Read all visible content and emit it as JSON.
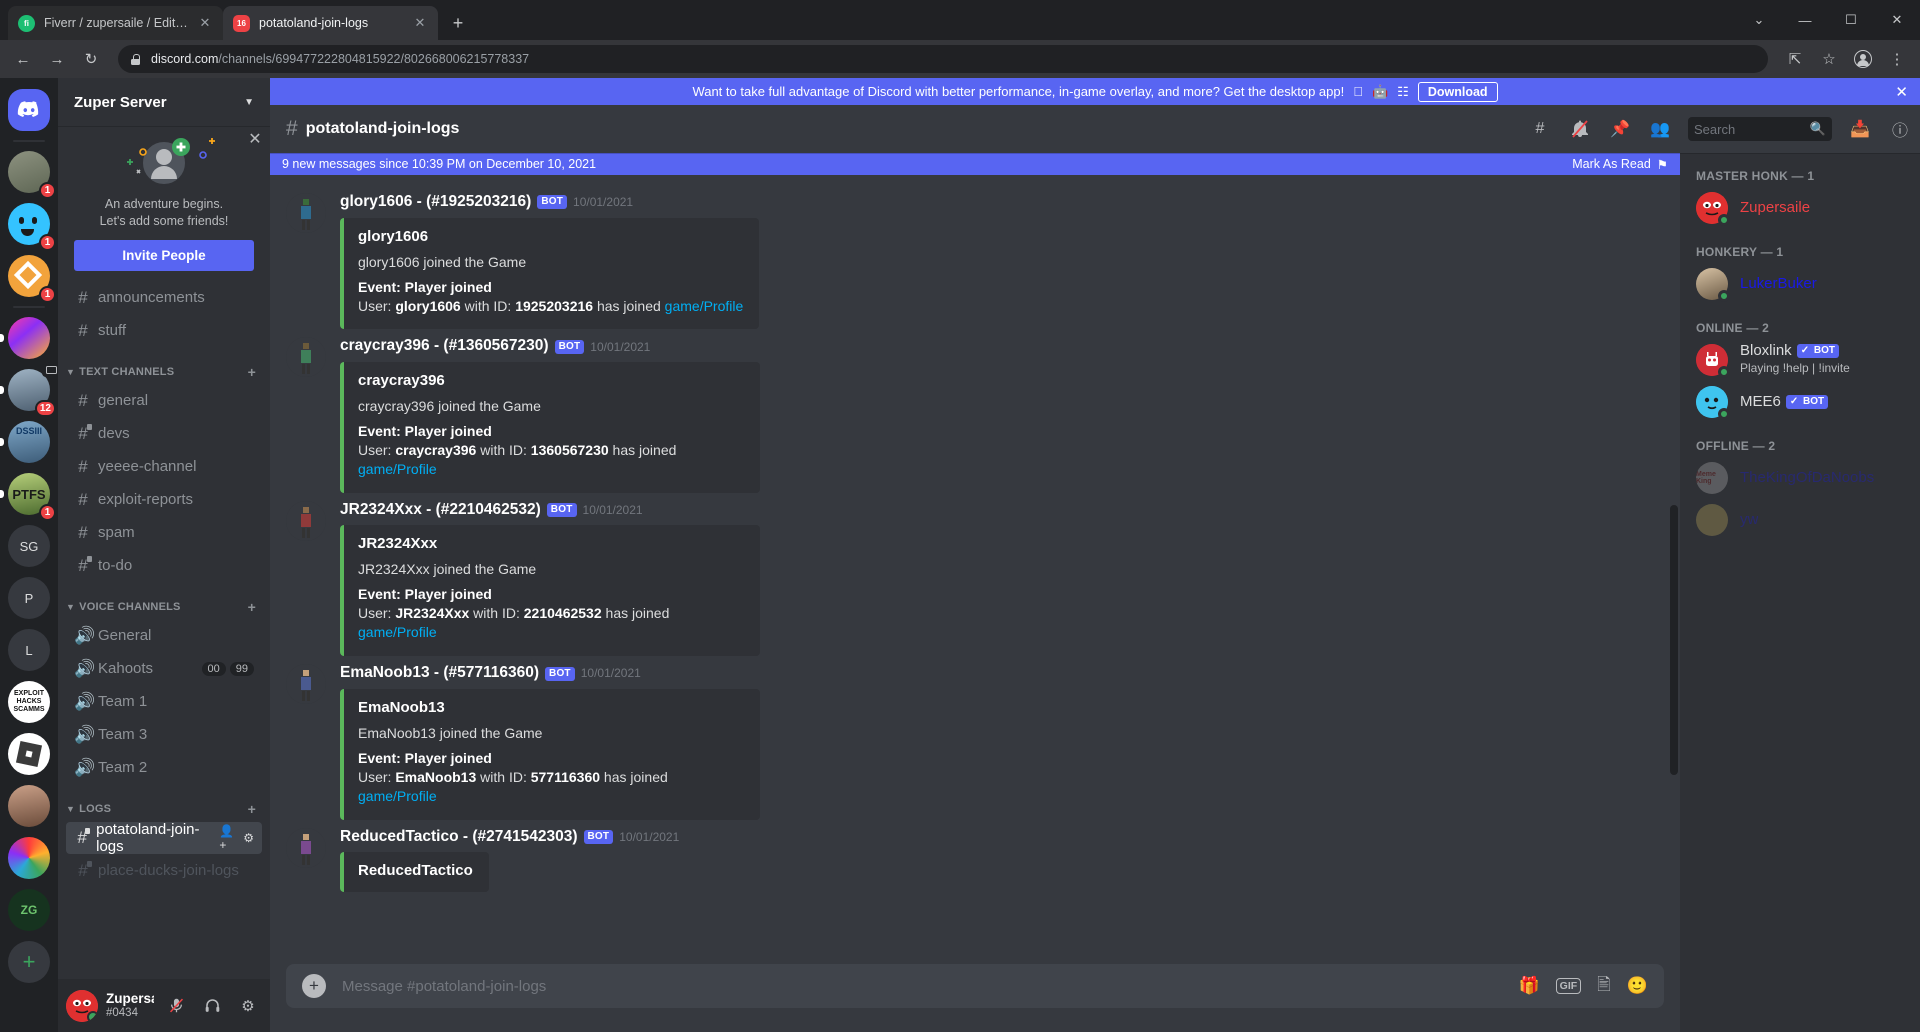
{
  "browser": {
    "tabs": [
      {
        "title": "Fiverr / zupersaile / Edit Gig",
        "favicon": "fiverr-icon",
        "active": false
      },
      {
        "title": "potatoland-join-logs",
        "favicon": "discord-icon",
        "active": true
      }
    ],
    "new_tab_label": "+",
    "url_domain": "discord.com",
    "url_path": "/channels/699477222804815922/802668006215778337",
    "window_controls": {
      "minimize": "—",
      "maximize": "☐",
      "close": "✕",
      "dropdown": "⌄"
    },
    "nav": {
      "back": "←",
      "forward": "→",
      "reload": "↻",
      "share": "share-icon",
      "star": "☆",
      "menu": "⋮"
    }
  },
  "server_rail": {
    "home_label": "discord-home",
    "servers": [
      {
        "name": "home",
        "badge": "",
        "unread": false,
        "color": "#5865f2",
        "initial": ""
      },
      {
        "name": "boat-server",
        "badge": "1",
        "unread": false,
        "color": "#7a7f6e",
        "initial": ""
      },
      {
        "name": "blue-face-server",
        "badge": "1",
        "unread": false,
        "color": "#34c3ff",
        "initial": ""
      },
      {
        "name": "orange-square-server",
        "badge": "1",
        "unread": false,
        "color": "#f2a33c",
        "initial": ""
      },
      {
        "name": "rainbow-emoji-server",
        "badge": "",
        "unread": true,
        "color": "#c13fd6",
        "initial": ""
      },
      {
        "name": "plane-server",
        "badge": "12",
        "unread": true,
        "color": "#6f8aa0",
        "initial": ""
      },
      {
        "name": "dossiii-server",
        "badge": "",
        "unread": true,
        "color": "#4c6f93",
        "initial": ""
      },
      {
        "name": "ptfs-server",
        "badge": "1",
        "unread": true,
        "color": "#6e8a4a",
        "initial": ""
      },
      {
        "name": "sg-server",
        "badge": "",
        "unread": false,
        "color": "#36393f",
        "initial": "SG"
      },
      {
        "name": "p-server",
        "badge": "",
        "unread": false,
        "color": "#36393f",
        "initial": "P"
      },
      {
        "name": "l-server",
        "badge": "",
        "unread": false,
        "color": "#36393f",
        "initial": "L"
      },
      {
        "name": "exploit-hacks-scamms-server",
        "badge": "",
        "unread": false,
        "color": "#ffffff",
        "initial": ""
      },
      {
        "name": "roblox-server",
        "badge": "",
        "unread": false,
        "color": "#ffffff",
        "initial": ""
      },
      {
        "name": "person-photo-server",
        "badge": "",
        "unread": false,
        "color": "#8a6f5a",
        "initial": ""
      },
      {
        "name": "rainbow-server",
        "badge": "",
        "unread": false,
        "color": "#2ba9d8",
        "initial": ""
      },
      {
        "name": "zg-server",
        "badge": "",
        "unread": false,
        "color": "#1f3d2b",
        "initial": "ZG"
      }
    ],
    "add_server_label": "+"
  },
  "sidebar": {
    "server_name": "Zuper Server",
    "promo": {
      "line1": "An adventure begins.",
      "line2": "Let's add some friends!",
      "button": "Invite People",
      "close": "✕"
    },
    "top_channels": [
      {
        "name": "announcements",
        "locked": false
      },
      {
        "name": "stuff",
        "locked": false
      }
    ],
    "categories": [
      {
        "name": "TEXT CHANNELS",
        "channels": [
          {
            "name": "general",
            "locked": false,
            "state": "normal"
          },
          {
            "name": "devs",
            "locked": true,
            "state": "normal"
          },
          {
            "name": "yeeee-channel",
            "locked": false,
            "state": "normal"
          },
          {
            "name": "exploit-reports",
            "locked": false,
            "state": "normal"
          },
          {
            "name": "spam",
            "locked": false,
            "state": "normal"
          },
          {
            "name": "to-do",
            "locked": true,
            "state": "normal"
          }
        ]
      },
      {
        "name": "VOICE CHANNELS",
        "channels": [
          {
            "name": "General",
            "voice": true,
            "state": "normal"
          },
          {
            "name": "Kahoots",
            "voice": true,
            "state": "normal",
            "badges": [
              "00",
              "99"
            ]
          },
          {
            "name": "Team 1",
            "voice": true,
            "state": "normal"
          },
          {
            "name": "Team 3",
            "voice": true,
            "state": "normal"
          },
          {
            "name": "Team 2",
            "voice": true,
            "state": "normal"
          }
        ]
      },
      {
        "name": "LOGS",
        "channels": [
          {
            "name": "potatoland-join-logs",
            "locked": true,
            "state": "active"
          },
          {
            "name": "place-ducks-join-logs",
            "locked": true,
            "state": "muted"
          }
        ]
      }
    ],
    "user": {
      "name": "Zupersaile",
      "tag": "#0434",
      "mic_icon": "mic-muted-icon",
      "headset_icon": "headphones-icon",
      "settings_icon": "gear-icon"
    }
  },
  "banner": {
    "text": "Want to take full advantage of Discord with better performance, in-game overlay, and more? Get the desktop app!",
    "download_label": "Download",
    "close": "✕",
    "platform_icons": [
      "apple-icon",
      "android-icon",
      "windows-icon"
    ]
  },
  "channel_header": {
    "title": "potatoland-join-logs",
    "icons": [
      "threads-icon",
      "notification-off-icon",
      "pin-icon",
      "members-icon"
    ],
    "search_placeholder": "Search",
    "right_icons": [
      "inbox-icon",
      "help-icon"
    ]
  },
  "new_messages_bar": {
    "text": "9 new messages since 10:39 PM on December 10, 2021",
    "mark_as_read": "Mark As Read"
  },
  "messages": [
    {
      "author": "glory1606 - (#1925203216)",
      "bot_label": "BOT",
      "timestamp": "10/01/2021",
      "embed": {
        "color": "#5bb85b",
        "title": "glory1606",
        "description": "glory1606 joined the Game",
        "field_name": "Event: Player joined",
        "field_prefix": "User: ",
        "field_user": "glory1606",
        "field_mid": " with ID: ",
        "field_id": "1925203216",
        "field_suffix": " has joined ",
        "link_game": "game",
        "link_sep": "/",
        "link_profile": "Profile"
      }
    },
    {
      "author": "craycray396 - (#1360567230)",
      "bot_label": "BOT",
      "timestamp": "10/01/2021",
      "embed": {
        "color": "#5bb85b",
        "title": "craycray396",
        "description": "craycray396 joined the Game",
        "field_name": "Event: Player joined",
        "field_prefix": "User: ",
        "field_user": "craycray396",
        "field_mid": " with ID: ",
        "field_id": "1360567230",
        "field_suffix": " has joined ",
        "link_game": "game",
        "link_sep": "/",
        "link_profile": "Profile"
      }
    },
    {
      "author": "JR2324Xxx - (#2210462532)",
      "bot_label": "BOT",
      "timestamp": "10/01/2021",
      "embed": {
        "color": "#5bb85b",
        "title": "JR2324Xxx",
        "description": "JR2324Xxx joined the Game",
        "field_name": "Event: Player joined",
        "field_prefix": "User: ",
        "field_user": "JR2324Xxx",
        "field_mid": " with ID: ",
        "field_id": "2210462532",
        "field_suffix": " has joined ",
        "link_game": "game",
        "link_sep": "/",
        "link_profile": "Profile"
      }
    },
    {
      "author": "EmaNoob13 - (#577116360)",
      "bot_label": "BOT",
      "timestamp": "10/01/2021",
      "embed": {
        "color": "#5bb85b",
        "title": "EmaNoob13",
        "description": "EmaNoob13 joined the Game",
        "field_name": "Event: Player joined",
        "field_prefix": "User: ",
        "field_user": "EmaNoob13",
        "field_mid": " with ID: ",
        "field_id": "577116360",
        "field_suffix": " has joined ",
        "link_game": "game",
        "link_sep": "/",
        "link_profile": "Profile"
      }
    },
    {
      "author": "ReducedTactico - (#2741542303)",
      "bot_label": "BOT",
      "timestamp": "10/01/2021",
      "embed": {
        "color": "#5bb85b",
        "title": "ReducedTactico",
        "description": "",
        "field_name": "",
        "field_prefix": "",
        "field_user": "",
        "field_mid": "",
        "field_id": "",
        "field_suffix": "",
        "link_game": "",
        "link_sep": "",
        "link_profile": ""
      }
    }
  ],
  "composer": {
    "placeholder": "Message #potatoland-join-logs",
    "add_icon": "plus-icon",
    "icons": [
      "gift-icon",
      "gif-icon",
      "sticker-icon",
      "emoji-icon"
    ],
    "gif_label": "GIF"
  },
  "members": {
    "groups": [
      {
        "title": "MASTER HONK — 1",
        "people": [
          {
            "name": "Zupersaile",
            "color": "#ed4245",
            "status": "online",
            "sub": "",
            "bot": false,
            "avatar_color": "#e03030"
          }
        ]
      },
      {
        "title": "HONKERY — 1",
        "people": [
          {
            "name": "LukerBuker",
            "color": "#1919e6",
            "status": "online",
            "sub": "",
            "bot": false,
            "avatar_color": "#8a7a63"
          }
        ]
      },
      {
        "title": "ONLINE — 2",
        "people": [
          {
            "name": "Bloxlink",
            "color": "#dcddde",
            "status": "online",
            "sub": "Playing !help | !invite",
            "bot": true,
            "bot_label": "BOT",
            "avatar_color": "#cf2d36"
          },
          {
            "name": "MEE6",
            "color": "#dcddde",
            "status": "online",
            "sub": "",
            "bot": true,
            "bot_label": "BOT",
            "avatar_color": "#3fc4ef"
          }
        ]
      },
      {
        "title": "OFFLINE — 2",
        "people": [
          {
            "name": "TheKingOfDaNoobs",
            "color": "#1919e6",
            "status": "offline",
            "sub": "",
            "bot": false,
            "avatar_color": "#b5b5b5",
            "dim": true
          },
          {
            "name": "yw",
            "color": "#1919e6",
            "status": "offline",
            "sub": "",
            "bot": false,
            "avatar_color": "#c4ae5e",
            "dim": true
          }
        ]
      }
    ]
  },
  "colors": {
    "accent": "#5865f2",
    "embed_green": "#5bb85b",
    "link": "#00aff4",
    "danger": "#ed4245"
  }
}
